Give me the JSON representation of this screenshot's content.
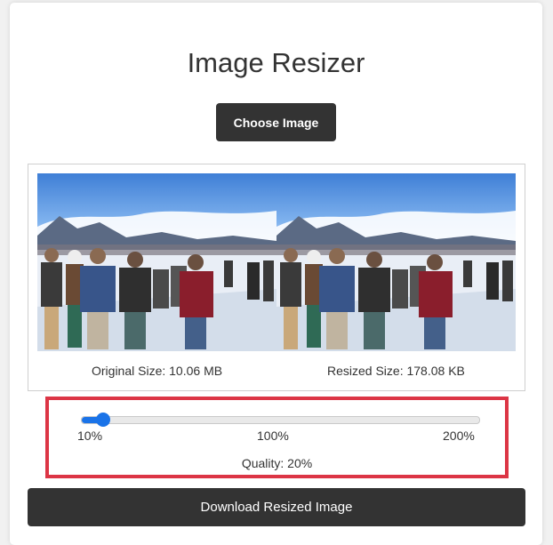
{
  "app": {
    "title": "Image Resizer"
  },
  "upload": {
    "choose_label": "Choose Image"
  },
  "preview": {
    "original_image_name": "original-photo",
    "resized_image_name": "resized-photo",
    "original_size_text": "Original Size: 10.06 MB",
    "resized_size_text": "Resized Size: 178.08 KB"
  },
  "slider": {
    "min_label": "10%",
    "mid_label": "100%",
    "max_label": "200%",
    "min": 10,
    "max": 200,
    "value": 20,
    "quality_text": "Quality: 20%"
  },
  "actions": {
    "download_label": "Download Resized Image"
  },
  "colors": {
    "accent": "#1a73e8",
    "button_bg": "#333333",
    "highlight": "#dc3545"
  }
}
